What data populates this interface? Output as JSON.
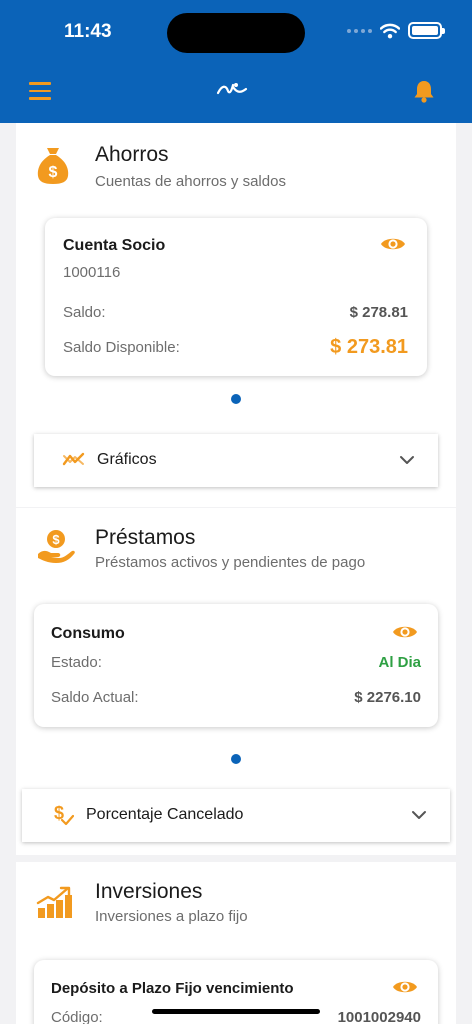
{
  "status_bar": {
    "time": "11:43"
  },
  "header": {
    "menu_icon": "hamburger-icon",
    "logo_icon": "app-logo-icon",
    "bell_icon": "bell-icon"
  },
  "colors": {
    "primary": "#0b63b8",
    "accent": "#f29a1f",
    "success": "#2ea043"
  },
  "savings": {
    "icon": "money-bag-icon",
    "title": "Ahorros",
    "subtitle": "Cuentas de ahorros y saldos",
    "card": {
      "title": "Cuenta Socio",
      "number": "1000116",
      "balance_label": "Saldo:",
      "balance_value": "$ 278.81",
      "available_label": "Saldo Disponible:",
      "available_value": "$ 273.81"
    },
    "expander_label": "Gráficos",
    "expander_icon": "trend-chart-icon"
  },
  "loans": {
    "icon": "hand-coin-icon",
    "title": "Préstamos",
    "subtitle": "Préstamos activos y pendientes de pago",
    "card": {
      "title": "Consumo",
      "status_label": "Estado:",
      "status_value": "Al Dia",
      "balance_label": "Saldo Actual:",
      "balance_value": "$ 2276.10"
    },
    "expander_label": "Porcentaje Cancelado",
    "expander_icon": "dollar-check-icon"
  },
  "investments": {
    "icon": "bar-chart-up-icon",
    "title": "Inversiones",
    "subtitle": "Inversiones a plazo fijo",
    "card": {
      "title": "Depósito a Plazo Fijo vencimiento",
      "code_label": "Código:",
      "code_value": "1001002940"
    }
  }
}
